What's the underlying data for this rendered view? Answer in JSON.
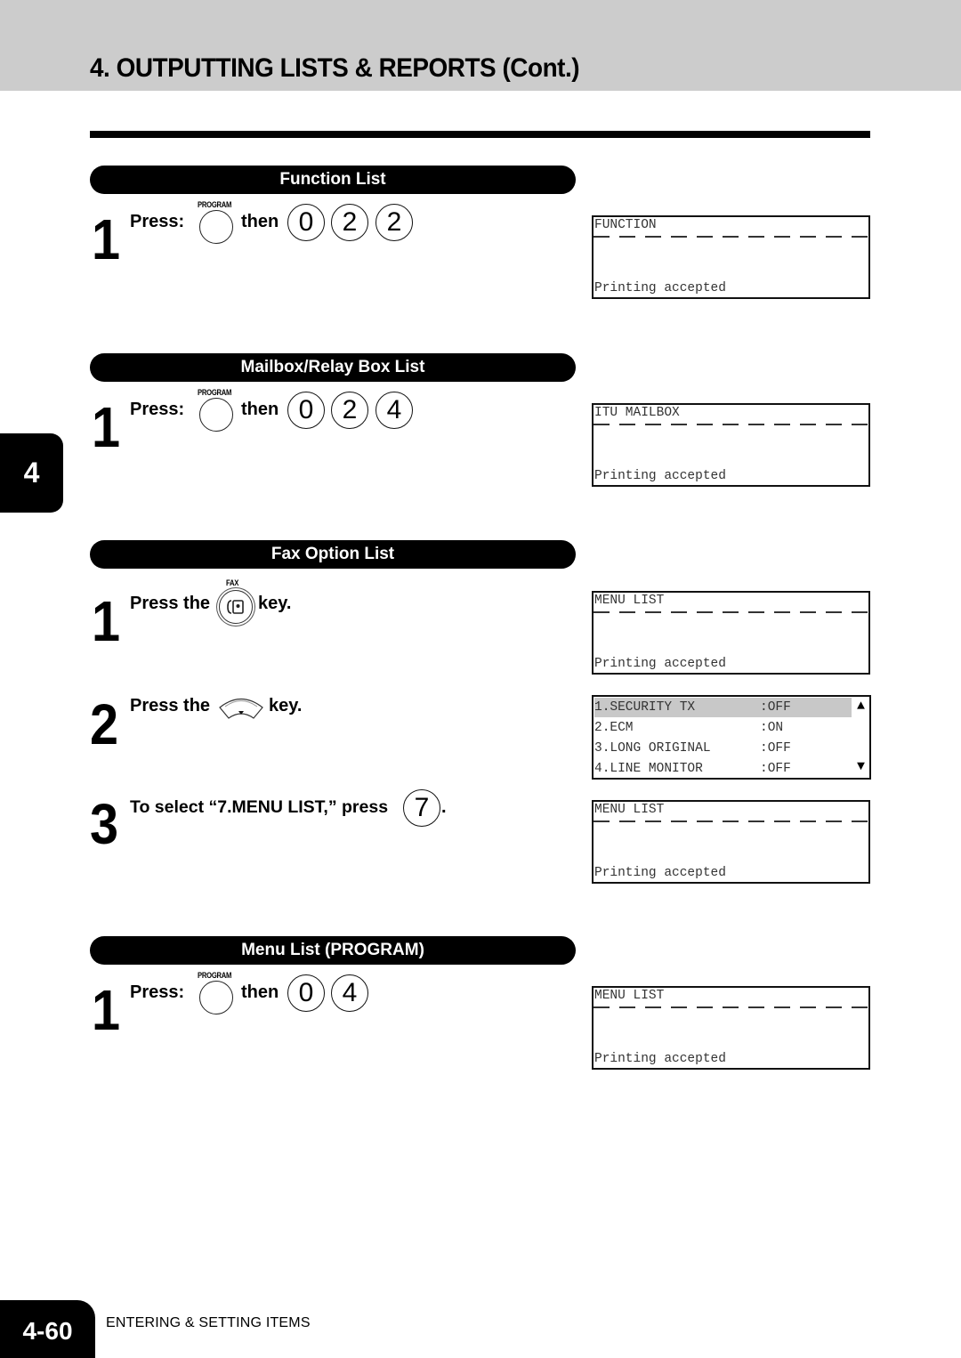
{
  "header": {
    "title": "4. OUTPUTTING LISTS & REPORTS (Cont.)"
  },
  "chapter_tab": "4",
  "sections": [
    {
      "title": "Function List",
      "steps": [
        {
          "number": "1",
          "press_label": "Press:",
          "key_label": "PROGRAM",
          "then_label": "then",
          "digits": [
            "0",
            "2",
            "2"
          ]
        }
      ],
      "displays": [
        {
          "line1": "FUNCTION",
          "line2": "Printing accepted"
        }
      ]
    },
    {
      "title": "Mailbox/Relay Box List",
      "steps": [
        {
          "number": "1",
          "press_label": "Press:",
          "key_label": "PROGRAM",
          "then_label": "then",
          "digits": [
            "0",
            "2",
            "4"
          ]
        }
      ],
      "displays": [
        {
          "line1": "ITU MAILBOX",
          "line2": "Printing accepted"
        }
      ]
    },
    {
      "title": "Fax Option List",
      "steps": [
        {
          "number": "1",
          "prefix": "Press the",
          "key_label": "FAX",
          "icon": "fax-key-icon",
          "suffix": "key."
        },
        {
          "number": "2",
          "prefix": "Press the",
          "icon": "down-arrow-key-icon",
          "suffix": "key."
        },
        {
          "number": "3",
          "prefix": "To select “7.MENU LIST,” press",
          "digit": "7",
          "suffix": "."
        }
      ],
      "displays": [
        {
          "line1": "MENU LIST",
          "line2": "Printing accepted"
        },
        {
          "line1": "MENU LIST",
          "line2": "Printing accepted"
        }
      ],
      "menu_display": {
        "rows": [
          {
            "label": "1.SECURITY TX",
            "value": ":OFF",
            "selected": true
          },
          {
            "label": "2.ECM",
            "value": ":ON",
            "selected": false
          },
          {
            "label": "3.LONG ORIGINAL",
            "value": ":OFF",
            "selected": false
          },
          {
            "label": "4.LINE MONITOR",
            "value": ":OFF",
            "selected": false
          }
        ],
        "scroll_up": "▲",
        "scroll_down": "▼"
      }
    },
    {
      "title": "Menu List (PROGRAM)",
      "steps": [
        {
          "number": "1",
          "press_label": "Press:",
          "key_label": "PROGRAM",
          "then_label": "then",
          "digits": [
            "0",
            "4"
          ]
        }
      ],
      "displays": [
        {
          "line1": "MENU LIST",
          "line2": "Printing accepted"
        }
      ]
    }
  ],
  "footer": {
    "page_number": "4-60",
    "chapter_name": "ENTERING & SETTING ITEMS"
  }
}
